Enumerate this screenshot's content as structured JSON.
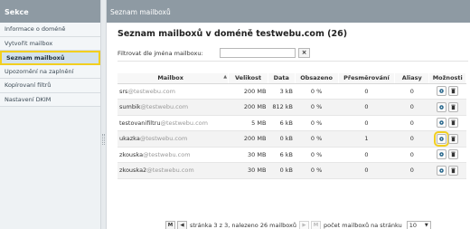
{
  "sidebar": {
    "title": "Sekce",
    "items": [
      {
        "label": "Informace o doméně"
      },
      {
        "label": "Vytvořit mailbox"
      },
      {
        "label": "Seznam mailboxů"
      },
      {
        "label": "Upozornění na zaplnění"
      },
      {
        "label": "Kopírovaní filtrů"
      },
      {
        "label": "Nastavení DKIM"
      }
    ],
    "active_index": 2
  },
  "main": {
    "header": "Seznam mailboxů",
    "title": "Seznam mailboxů v doméně testwebu.com (26)",
    "filter": {
      "label": "Filtrovat dle jména mailboxu:",
      "value": "",
      "clear_label": "×"
    },
    "table": {
      "headers": {
        "mailbox": "Mailbox",
        "size": "Velikost",
        "data": "Data",
        "content": "Obsazeno",
        "forwarding": "Přesměrování",
        "aliases": "Aliasy",
        "options": "Možnosti"
      },
      "sort_indicator": "▲",
      "rows": [
        {
          "user": "srs",
          "domain": "@testwebu.com",
          "size": "200 MB",
          "data": "3 kB",
          "content": "0 %",
          "forwarding": "0",
          "aliases": "0"
        },
        {
          "user": "sumbik",
          "domain": "@testwebu.com",
          "size": "200 MB",
          "data": "812 kB",
          "content": "0 %",
          "forwarding": "0",
          "aliases": "0"
        },
        {
          "user": "testovanifiltru",
          "domain": "@testwebu.com",
          "size": "5 MB",
          "data": "6 kB",
          "content": "0 %",
          "forwarding": "0",
          "aliases": "0"
        },
        {
          "user": "ukazka",
          "domain": "@testwebu.com",
          "size": "200 MB",
          "data": "0 kB",
          "content": "0 %",
          "forwarding": "1",
          "aliases": "0"
        },
        {
          "user": "zkouska",
          "domain": "@testwebu.com",
          "size": "30 MB",
          "data": "6 kB",
          "content": "0 %",
          "forwarding": "0",
          "aliases": "0"
        },
        {
          "user": "zkouska2",
          "domain": "@testwebu.com",
          "size": "30 MB",
          "data": "0 kB",
          "content": "0 %",
          "forwarding": "0",
          "aliases": "0"
        }
      ],
      "highlighted_row": 3
    },
    "pager": {
      "first": "M",
      "prev": "◀",
      "next": "▶",
      "last": "M",
      "text": "stránka 3 z 3, nalezeno 26 mailboxů",
      "per_page_label": "počet mailboxů na stránku",
      "per_page_value": "10",
      "select_arrow": "▼"
    }
  },
  "colors": {
    "accent_highlight": "#f2cf1f",
    "header_bg": "#8e9aa3"
  }
}
